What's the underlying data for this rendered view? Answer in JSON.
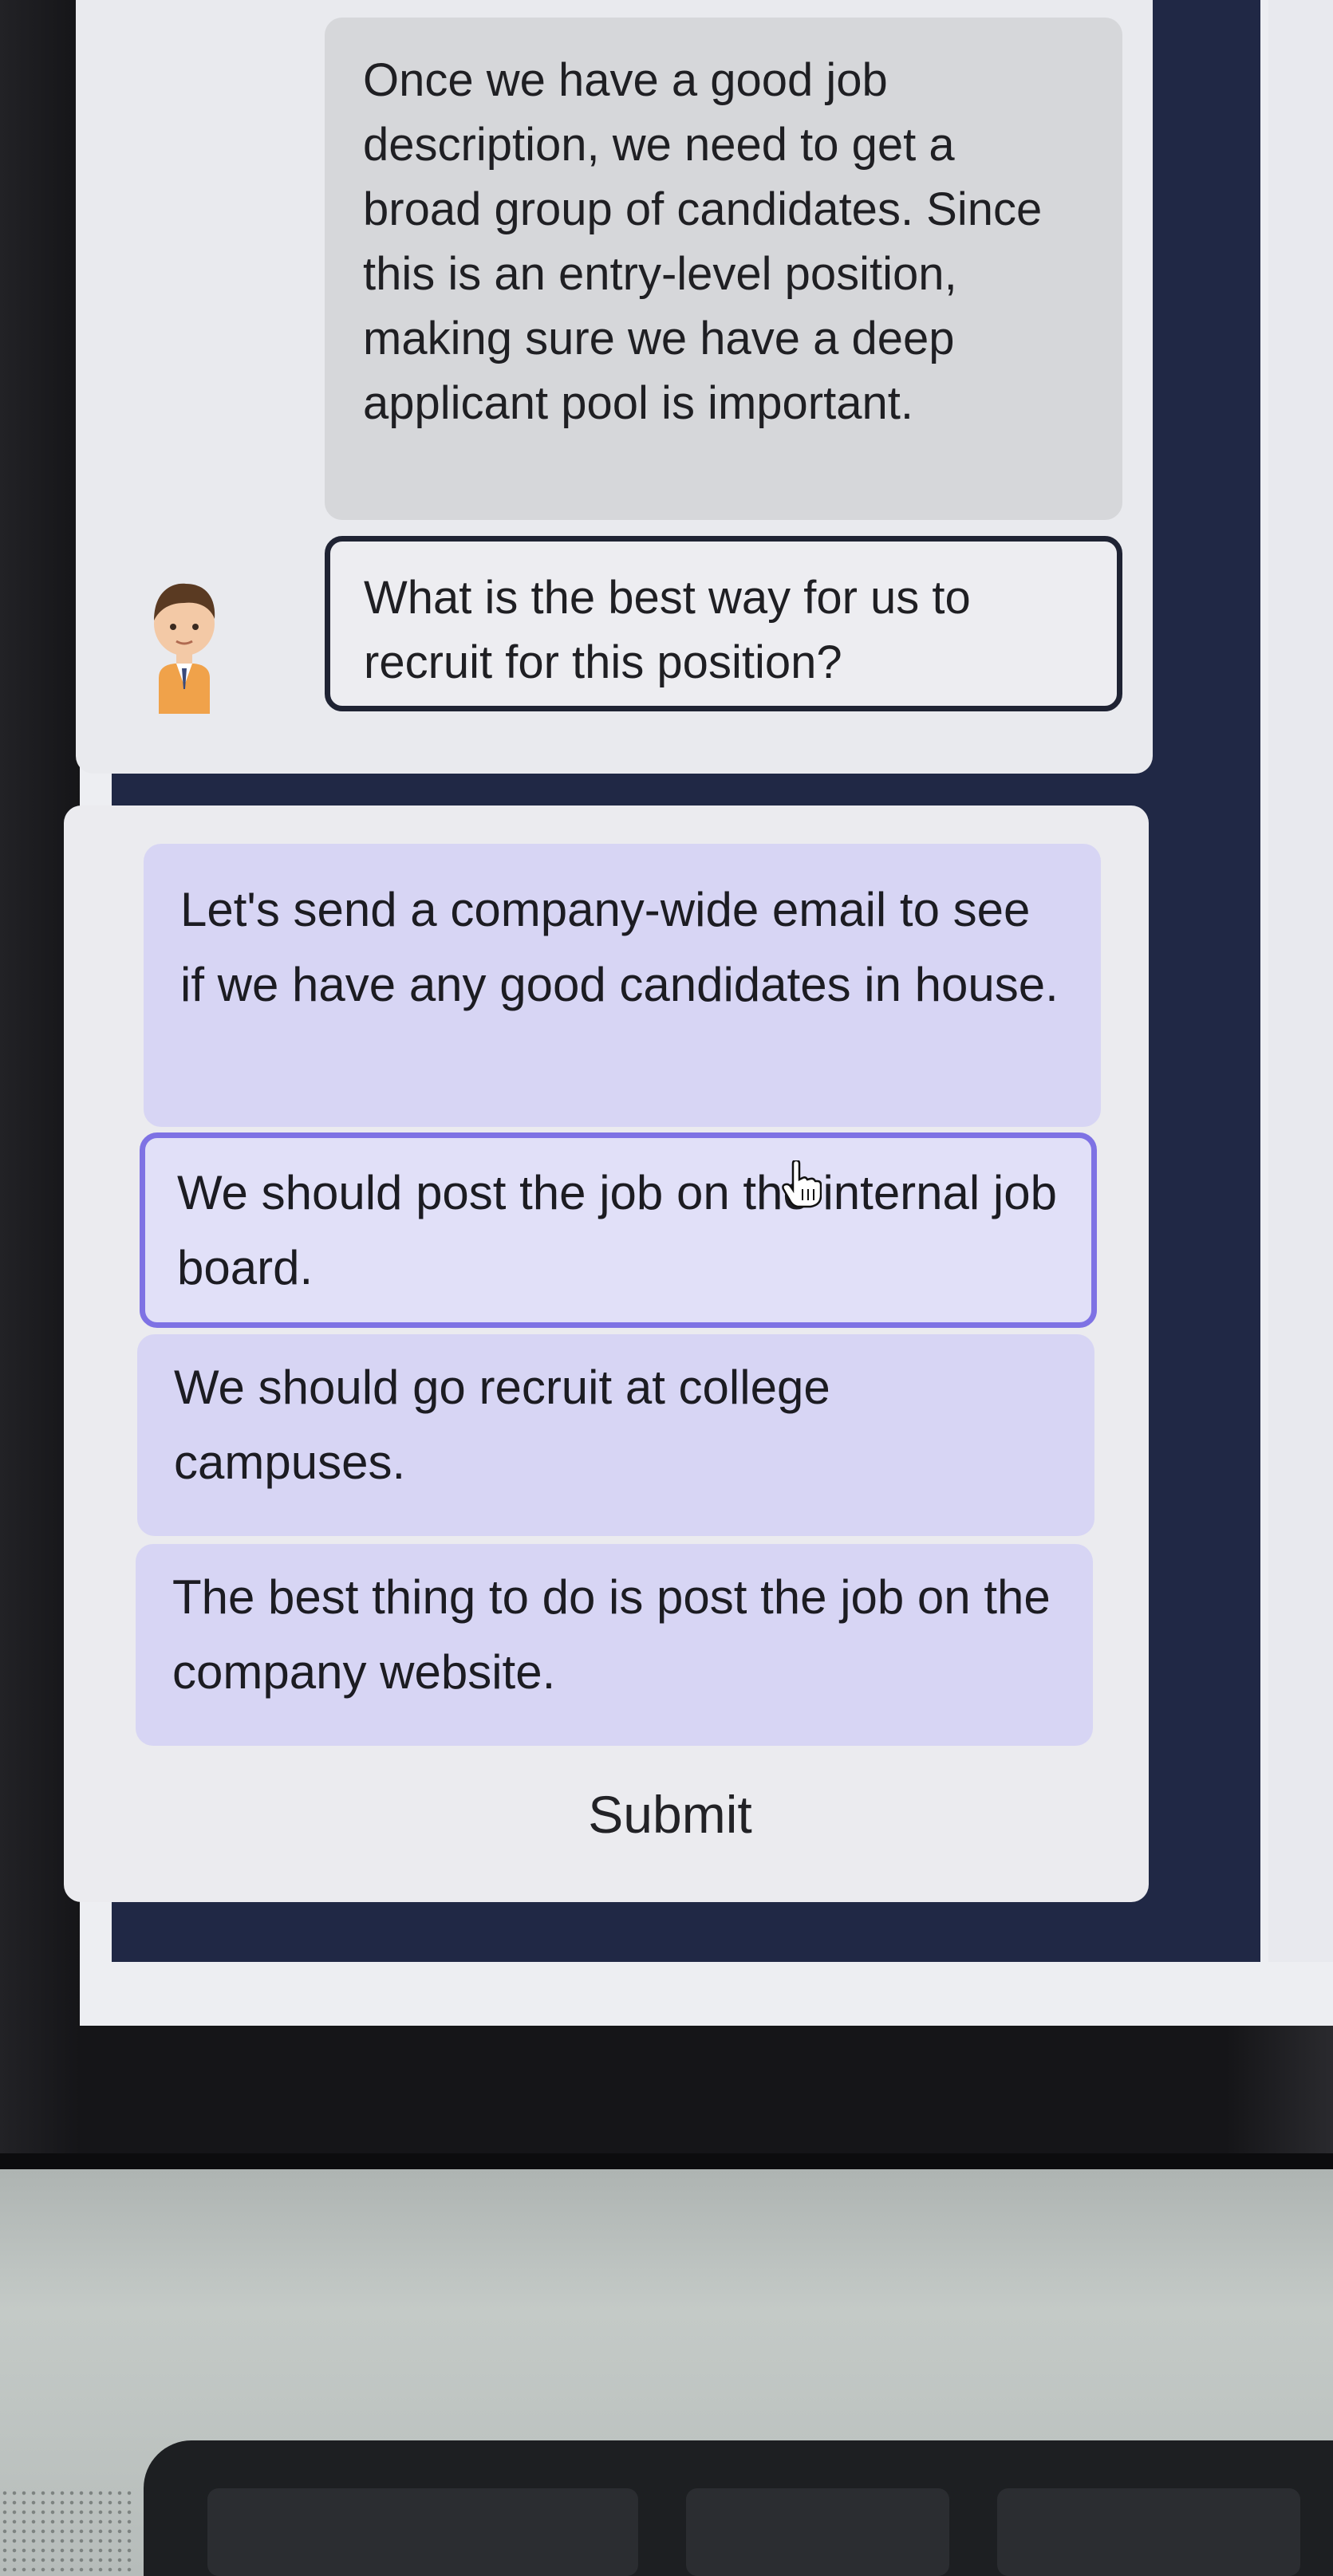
{
  "conversation": {
    "npc_message": "Once we have a good job description, we need to get a broad group of candidates. Since this is an entry-level position, making sure we have a deep applicant pool is important.",
    "player_question": "What is the best way for us to recruit for this position?",
    "avatar_icon": "businessman-avatar-icon"
  },
  "choices": {
    "options": [
      {
        "label": "Let's send a company-wide email to see if we have any good candidates in house.",
        "selected": false
      },
      {
        "label": "We should post the job on the internal job board.",
        "selected": true
      },
      {
        "label": "We should go recruit at college campuses.",
        "selected": false
      },
      {
        "label": "The best thing to do is post the job on the company website.",
        "selected": false
      }
    ],
    "submit_label": "Submit"
  },
  "colors": {
    "option_bg": "#d7d5f4",
    "selected_border": "#7e72e4",
    "frame": "#202845",
    "npc_bubble": "#d6d7da"
  }
}
